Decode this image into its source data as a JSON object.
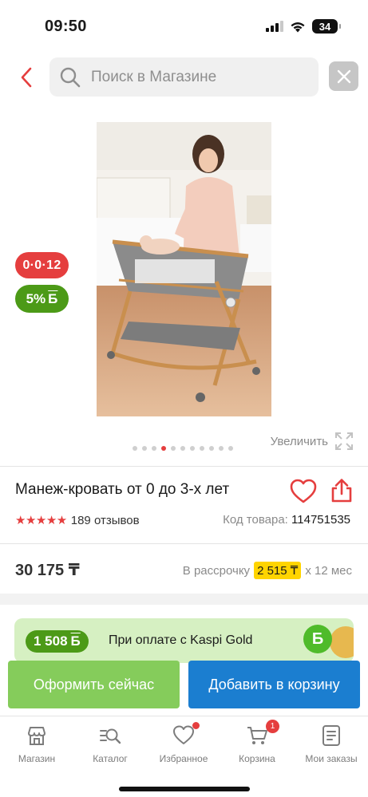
{
  "status_bar": {
    "time": "09:50",
    "battery": "34"
  },
  "search": {
    "placeholder": "Поиск в Магазине"
  },
  "icons": {
    "back": "chevron-left-icon",
    "search": "search-icon",
    "clear": "close-icon",
    "zoom": "expand-icon",
    "favorite": "heart-icon",
    "share": "share-icon"
  },
  "badges": {
    "installment": "0·0·12",
    "bonus_percent": "5%",
    "bonus_sign": "Б"
  },
  "gallery": {
    "total_images": 11,
    "active_index": 3,
    "zoom_label": "Увеличить"
  },
  "product": {
    "title": "Манеж-кровать от 0 до 3-х лет",
    "rating": 5,
    "reviews": "189 отзывов",
    "sku_label": "Код товара:",
    "sku_value": "114751535",
    "price": "30 175 ₸",
    "installment_label": "В рассрочку",
    "installment_amount": "2 515 ₸",
    "installment_term": "х 12 мес"
  },
  "kaspi_banner": {
    "amount": "1 508",
    "bonus_sign": "Б",
    "text": "При оплате с Kaspi Gold"
  },
  "actions": {
    "buy_now": "Оформить сейчас",
    "add_to_cart": "Добавить в корзину"
  },
  "tabbar": {
    "items": [
      {
        "label": "Магазин",
        "icon": "shop-icon"
      },
      {
        "label": "Каталог",
        "icon": "catalog-search-icon"
      },
      {
        "label": "Избранное",
        "icon": "heart-icon",
        "has_dot": true
      },
      {
        "label": "Корзина",
        "icon": "cart-icon",
        "badge": "1"
      },
      {
        "label": "Мои заказы",
        "icon": "orders-icon"
      }
    ]
  },
  "colors": {
    "accent_red": "#e53e3e",
    "bonus_green": "#4c9a17",
    "buy_green": "#85cc5b",
    "cart_blue": "#1b7ed0",
    "installment_yellow": "#ffd400"
  }
}
